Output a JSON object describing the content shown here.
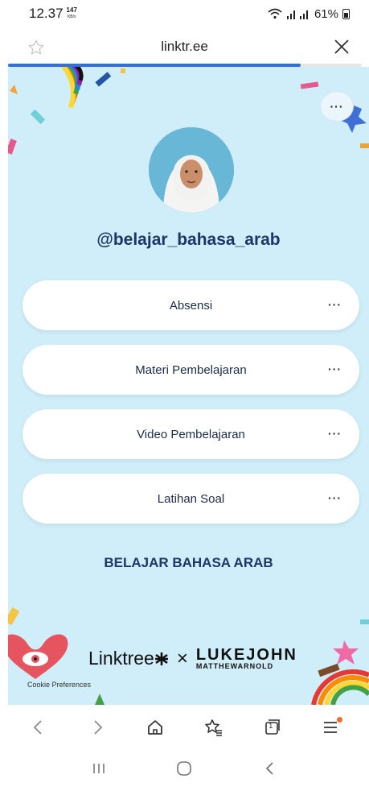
{
  "status_bar": {
    "time": "12.37",
    "speed_value": "147",
    "speed_unit": "KB/s",
    "battery": "61%"
  },
  "browser": {
    "url": "linktr.ee"
  },
  "profile": {
    "handle": "@belajar_bahasa_arab"
  },
  "links": [
    {
      "label": "Absensi"
    },
    {
      "label": "Materi Pembelajaran"
    },
    {
      "label": "Video Pembelajaran"
    },
    {
      "label": "Latihan Soal"
    }
  ],
  "footer": {
    "title": "BELAJAR BAHASA ARAB",
    "brand_linktree": "Linktree",
    "brand_x": "×",
    "brand_luke": "LUKEJOHN",
    "brand_matthew": "MATTHEWARNOLD",
    "cookie": "Cookie Preferences"
  },
  "colors": {
    "page_bg": "#cfeef9",
    "heading": "#1d3567",
    "progress": "#2f6fe0",
    "notification_dot": "#f36b2c"
  },
  "icons": {
    "bookmark": "star-icon",
    "close": "close-icon",
    "more": "more-dots-icon",
    "nav": [
      "back-icon",
      "forward-icon",
      "home-icon",
      "bookmarks-icon",
      "tabs-icon",
      "menu-icon"
    ],
    "android": [
      "recents-icon",
      "home-circle-icon",
      "back-chevron-icon"
    ]
  },
  "tabs_count": "1"
}
